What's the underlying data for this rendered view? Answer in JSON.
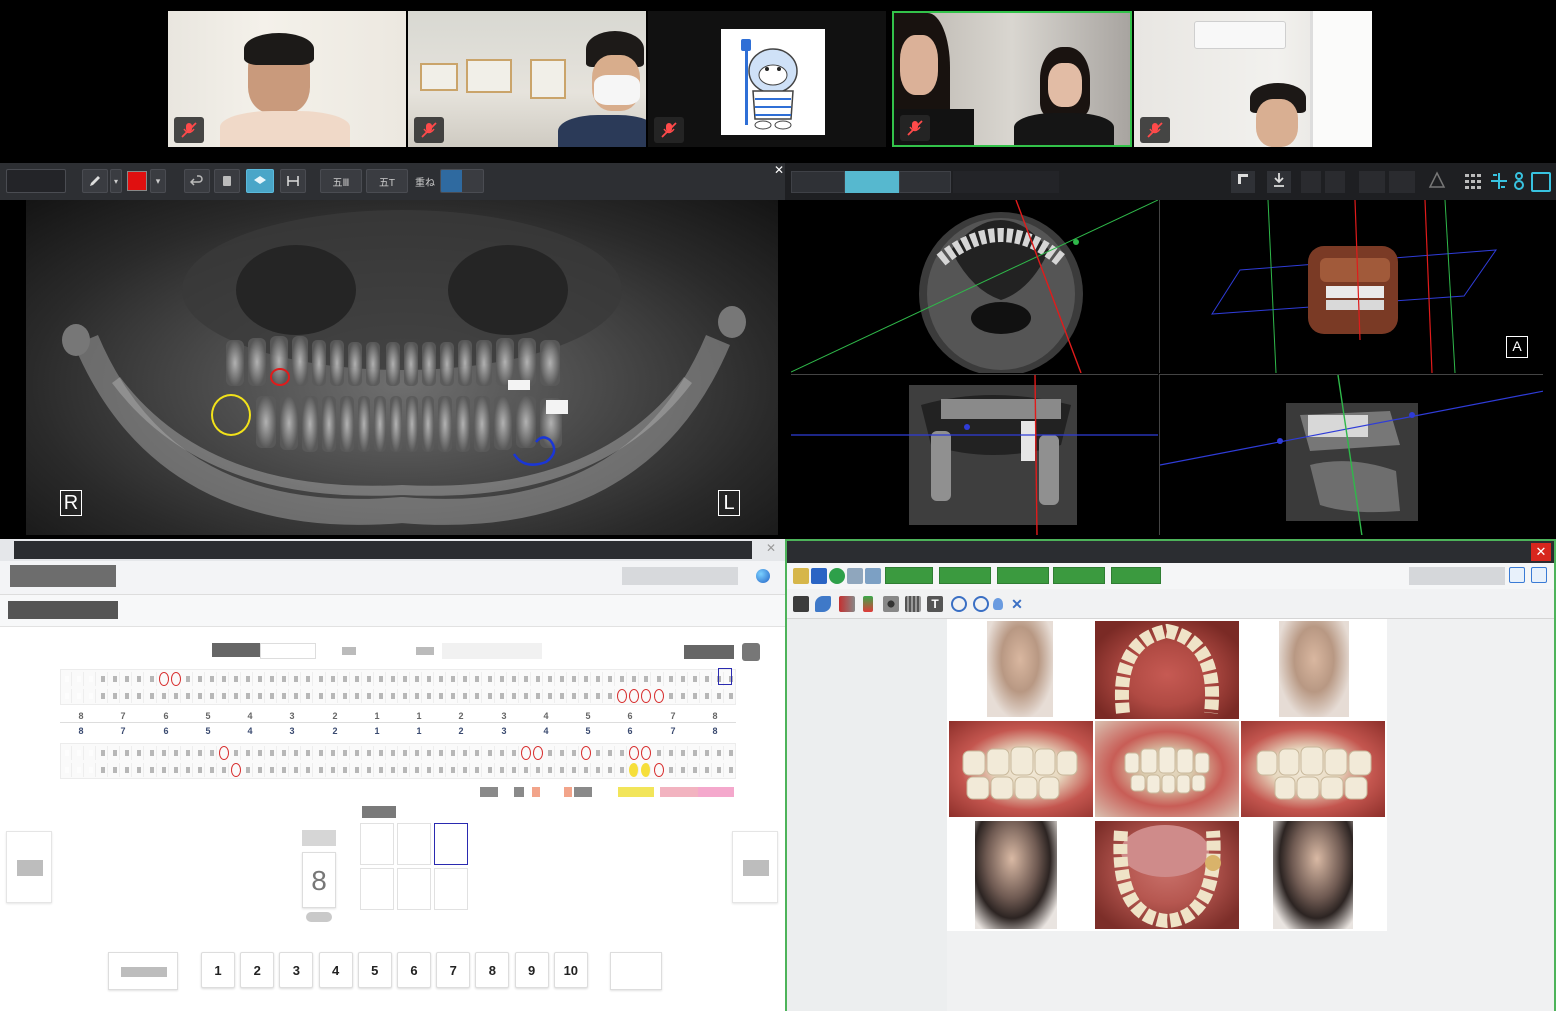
{
  "video_call": {
    "participants": [
      {
        "name": "participant-1",
        "muted": true
      },
      {
        "name": "participant-2",
        "muted": true
      },
      {
        "name": "participant-3-avatar",
        "muted": true
      },
      {
        "name": "participant-4",
        "muted": true,
        "active_speaker": true
      },
      {
        "name": "participant-5",
        "muted": true
      }
    ]
  },
  "xray_viewer": {
    "labels": {
      "right": "R",
      "left": "L"
    },
    "toolbar": {
      "btn1": "五Ⅲ",
      "btn2": "五T",
      "btn3": "重ね"
    },
    "pen_color": "#e01010"
  },
  "ct_viewer": {
    "view_label": "A"
  },
  "dental_chart": {
    "upper_numbers": [
      "8",
      "7",
      "6",
      "5",
      "4",
      "3",
      "2",
      "1",
      "1",
      "2",
      "3",
      "4",
      "5",
      "6",
      "7",
      "8"
    ],
    "lower_numbers": [
      "8",
      "7",
      "6",
      "5",
      "4",
      "3",
      "2",
      "1",
      "1",
      "2",
      "3",
      "4",
      "5",
      "6",
      "7",
      "8"
    ],
    "tooth_selector_value": "8",
    "pages": [
      "1",
      "2",
      "3",
      "4",
      "5",
      "6",
      "7",
      "8",
      "9",
      "10"
    ]
  },
  "photo_viewer": {
    "close_icon": "close-icon"
  }
}
